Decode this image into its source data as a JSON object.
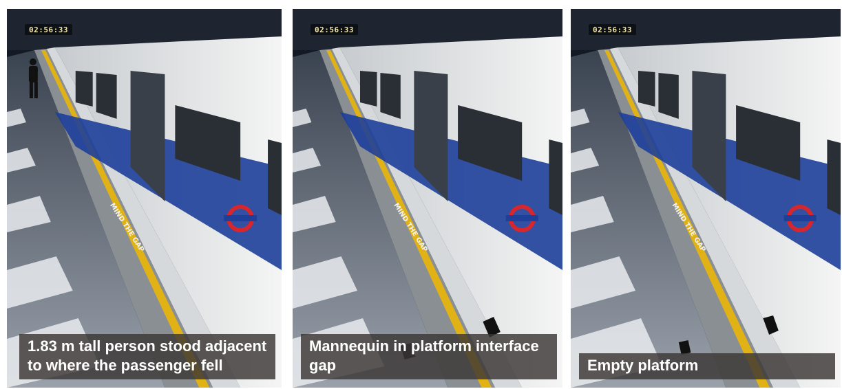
{
  "panels": [
    {
      "timestamp": "02:56:33",
      "caption": "1.83 m tall person stood adjacent to where the passenger fell",
      "floor_marking": "MIND THE GAP"
    },
    {
      "timestamp": "02:56:33",
      "caption": "Mannequin in platform interface gap",
      "floor_marking": "MIND THE GAP"
    },
    {
      "timestamp": "02:56:33",
      "caption": "Empty platform",
      "floor_marking": "MIND THE GAP"
    }
  ],
  "colors": {
    "train_body": "#f1f2f0",
    "train_blue_band": "#1e3f9a",
    "roundel_red": "#d7262c",
    "safety_line_yellow": "#e1b216",
    "caption_bg": "#3a3634"
  }
}
